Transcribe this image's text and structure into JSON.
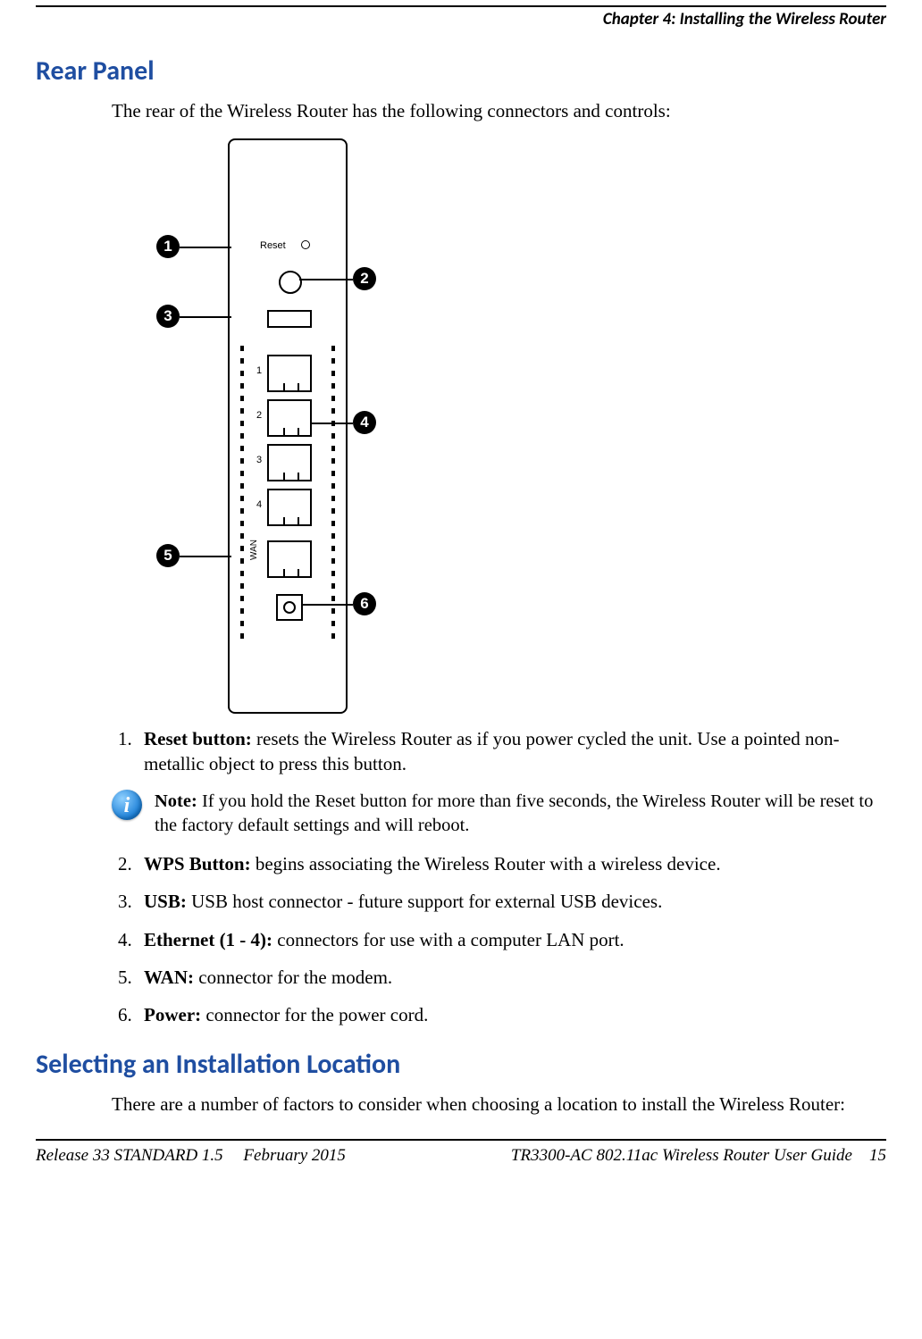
{
  "running_head": "Chapter 4: Installing the Wireless Router",
  "section1_title": "Rear Panel",
  "section1_intro": "The rear of the Wireless Router has the following connectors and controls:",
  "router_labels": {
    "reset": "Reset",
    "wan": "WAN",
    "lan_numbers": [
      "1",
      "2",
      "3",
      "4"
    ]
  },
  "callouts": [
    "1",
    "2",
    "3",
    "4",
    "5",
    "6"
  ],
  "rear_items": [
    {
      "num": "1.",
      "label": "Reset button:",
      "text": " resets the Wireless Router as if you power cycled the unit. Use a pointed non-metallic object to press this button."
    }
  ],
  "note": {
    "label": "Note:",
    "text": " If you hold the Reset button for more than five seconds, the Wireless Router will be reset to the factory default settings and will reboot."
  },
  "rear_items_cont": [
    {
      "num": "2.",
      "label": "WPS Button:",
      "text": " begins associating the Wireless Router with a wireless device."
    },
    {
      "num": "3.",
      "label": "USB:",
      "text": " USB host connector - future support for external USB devices."
    },
    {
      "num": "4.",
      "label": "Ethernet (1 - 4):",
      "text": " connectors for use with a computer LAN port."
    },
    {
      "num": "5.",
      "label": "WAN:",
      "text": " connector for the modem."
    },
    {
      "num": "6.",
      "label": "Power:",
      "text": " connector for the power cord."
    }
  ],
  "section2_title": "Selecting an Installation Location",
  "section2_intro": "There are a number of factors to consider when choosing a location to install the Wireless Router:",
  "footer": {
    "release": "Release 33 STANDARD 1.5",
    "date": "February 2015",
    "guide": "TR3300-AC 802.11ac Wireless Router User Guide",
    "page": "15"
  }
}
